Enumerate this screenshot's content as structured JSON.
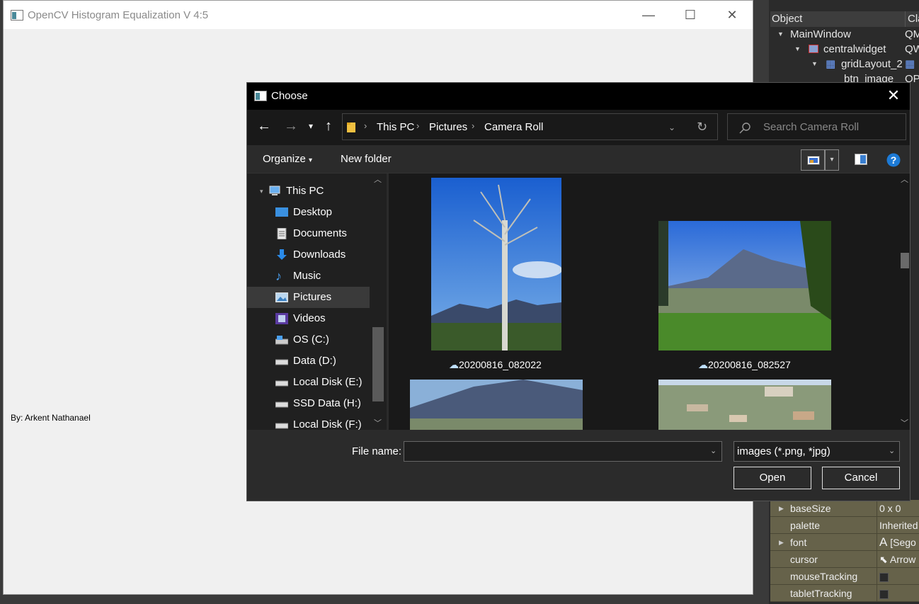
{
  "app": {
    "title": "OpenCV Histogram Equalization V 4:5",
    "author": "By: Arkent Nathanael"
  },
  "designer": {
    "headers": {
      "object": "Object",
      "class": "Cla"
    },
    "tree": [
      {
        "label": "MainWindow",
        "cls": "QM"
      },
      {
        "label": "centralwidget",
        "cls": "QW"
      },
      {
        "label": "gridLayout_2",
        "cls": "▦"
      },
      {
        "label": "btn_image",
        "cls": "QP"
      }
    ],
    "props": [
      {
        "name": "baseSize",
        "value": "0 x 0"
      },
      {
        "name": "palette",
        "value": "Inherited"
      },
      {
        "name": "font",
        "value": "[Sego"
      },
      {
        "name": "cursor",
        "value": "Arrow"
      },
      {
        "name": "mouseTracking",
        "value": ""
      },
      {
        "name": "tabletTracking",
        "value": ""
      }
    ]
  },
  "dialog": {
    "title": "Choose",
    "breadcrumb": [
      "This PC",
      "Pictures",
      "Camera Roll"
    ],
    "search_placeholder": "Search Camera Roll",
    "toolbar": {
      "organize": "Organize",
      "new_folder": "New folder"
    },
    "nav": [
      {
        "label": "This PC",
        "icon": "pc-icon"
      },
      {
        "label": "Desktop",
        "icon": "desktop-icon"
      },
      {
        "label": "Documents",
        "icon": "documents-icon"
      },
      {
        "label": "Downloads",
        "icon": "downloads-icon"
      },
      {
        "label": "Music",
        "icon": "music-icon"
      },
      {
        "label": "Pictures",
        "icon": "pictures-icon"
      },
      {
        "label": "Videos",
        "icon": "videos-icon"
      },
      {
        "label": "OS (C:)",
        "icon": "drive-icon"
      },
      {
        "label": "Data (D:)",
        "icon": "drive-icon"
      },
      {
        "label": "Local Disk (E:)",
        "icon": "drive-icon"
      },
      {
        "label": "SSD Data (H:)",
        "icon": "drive-icon"
      },
      {
        "label": "Local Disk (F:)",
        "icon": "drive-icon"
      }
    ],
    "files": [
      {
        "name": "20200816_082022"
      },
      {
        "name": "20200816_082527"
      }
    ],
    "file_name_label": "File name:",
    "file_name_value": "",
    "file_type": "images (*.png, *jpg)",
    "open_label": "Open",
    "cancel_label": "Cancel"
  }
}
